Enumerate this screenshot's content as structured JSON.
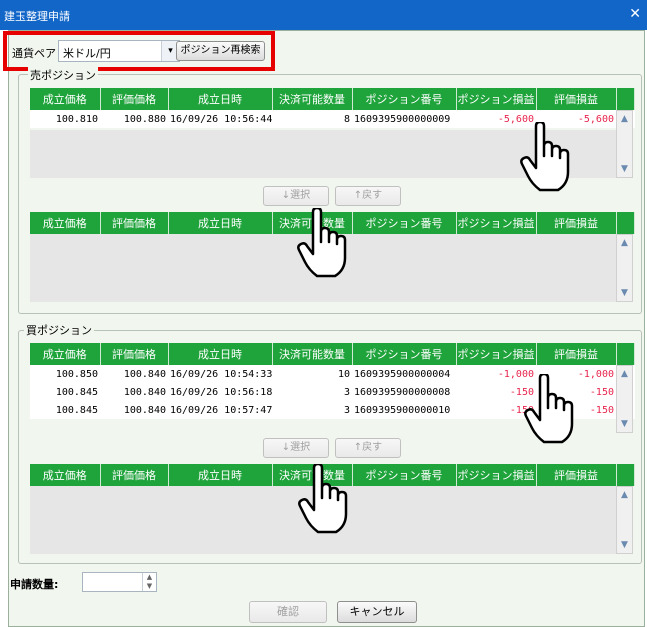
{
  "window": {
    "title": "建玉整理申請",
    "close_glyph": "✕"
  },
  "currency": {
    "label": "通貨ペア",
    "selected": "米ドル/円",
    "dropdown_arrow": "▾",
    "research_button": "ポジション再検索"
  },
  "columns": [
    "成立価格",
    "評価価格",
    "成立日時",
    "決済可能数量",
    "ポジション番号",
    "ポジション損益",
    "評価損益"
  ],
  "sell": {
    "legend": "売ポジション",
    "rows": [
      {
        "price": "100.810",
        "eval_price": "100.880",
        "datetime": "16/09/26 10:56:44",
        "qty": "8",
        "position_no": "1609395900000009",
        "pnl": "-5,600",
        "eval_pnl": "-5,600"
      }
    ],
    "select_button": "↓選択",
    "return_button": "↑戻す"
  },
  "buy": {
    "legend": "買ポジション",
    "rows": [
      {
        "price": "100.850",
        "eval_price": "100.840",
        "datetime": "16/09/26 10:54:33",
        "qty": "10",
        "position_no": "1609395900000004",
        "pnl": "-1,000",
        "eval_pnl": "-1,000"
      },
      {
        "price": "100.845",
        "eval_price": "100.840",
        "datetime": "16/09/26 10:56:18",
        "qty": "3",
        "position_no": "1609395900000008",
        "pnl": "-150",
        "eval_pnl": "-150"
      },
      {
        "price": "100.845",
        "eval_price": "100.840",
        "datetime": "16/09/26 10:57:47",
        "qty": "3",
        "position_no": "1609395900000010",
        "pnl": "-150",
        "eval_pnl": "-150"
      }
    ],
    "select_button": "↓選択",
    "return_button": "↑戻す"
  },
  "quantity": {
    "label": "申請数量:",
    "value": ""
  },
  "footer": {
    "confirm": "確認",
    "cancel": "キャンセル"
  },
  "colors": {
    "titlebar": "#1266c8",
    "header_green": "#1fa33b",
    "negative": "#e8254d",
    "highlight_box": "#e60000"
  },
  "icons": [
    "close-icon",
    "dropdown-arrow-icon",
    "scroll-up-icon",
    "scroll-down-icon",
    "spinner-icon",
    "pointing-hand-icon"
  ]
}
